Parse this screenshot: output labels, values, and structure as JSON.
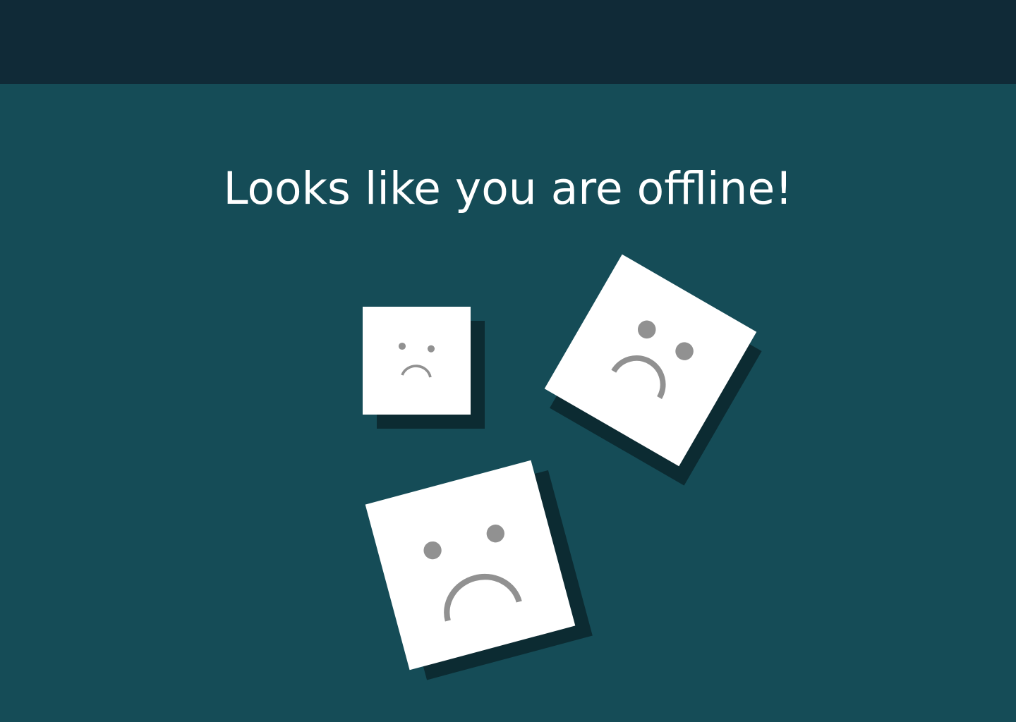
{
  "page": {
    "headline": "Looks like you are offline!"
  },
  "icons": {
    "sad_face": "sad-face-icon"
  },
  "colors": {
    "topbar": "#102a37",
    "background": "#154c57",
    "tile": "#ffffff",
    "tile_shadow": "#0c2b32",
    "face": "#919191",
    "text": "#ffffff"
  }
}
